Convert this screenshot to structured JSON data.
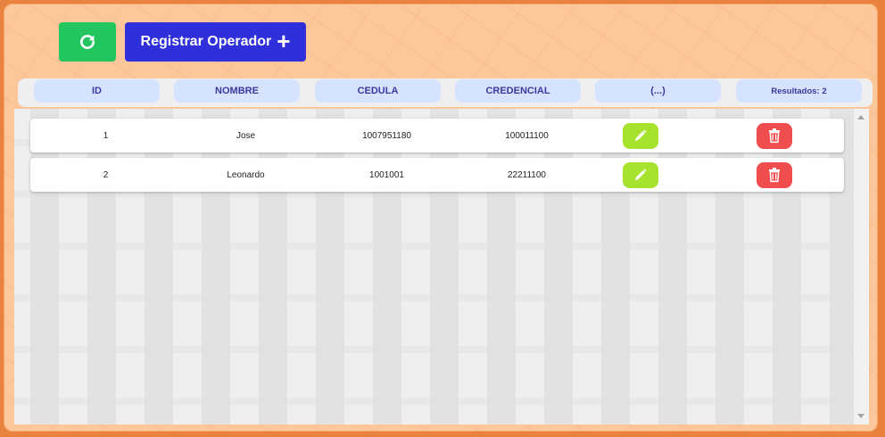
{
  "toolbar": {
    "refresh_icon": "refresh-icon",
    "add_label": "Registrar Operador",
    "add_icon": "plus-icon"
  },
  "table": {
    "headers": [
      "ID",
      "NOMBRE",
      "CEDULA",
      "CREDENCIAL",
      "(...)",
      "Resultados: 2"
    ],
    "rows": [
      {
        "id": "1",
        "nombre": "Jose",
        "cedula": "1007951180",
        "credencial": "100011100"
      },
      {
        "id": "2",
        "nombre": "Leonardo",
        "cedula": "1001001",
        "credencial": "22211100"
      }
    ],
    "edit_icon": "pencil-icon",
    "delete_icon": "trash-icon"
  },
  "colors": {
    "background": "#e9823f",
    "panel": "#fdc79c",
    "refresh_button": "#22c55e",
    "add_button": "#2f2fdc",
    "header_pill": "#d6e3ff",
    "edit_button": "#a6e22e",
    "delete_button": "#f04e4e"
  }
}
